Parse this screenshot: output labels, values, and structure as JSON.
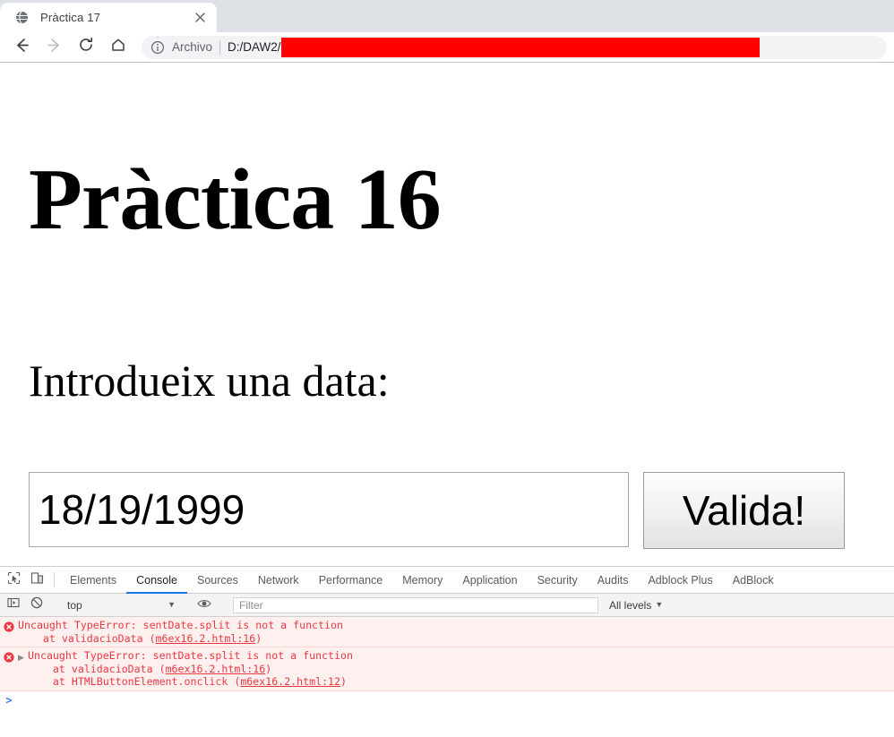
{
  "browser": {
    "tab": {
      "title": "Pràctica 17",
      "favicon_icon": "globe-icon",
      "close_icon": "close-icon"
    },
    "new_tab_icon": "plus-icon",
    "nav": {
      "back_icon": "arrow-left-icon",
      "forward_icon": "arrow-right-icon",
      "reload_icon": "reload-icon",
      "home_icon": "home-icon"
    },
    "omnibox": {
      "info_icon": "info-circle-icon",
      "scheme_label": "Archivo",
      "path": "D:/DAW2/",
      "redaction_color": "#fe0000"
    }
  },
  "page": {
    "heading": "Pràctica 16",
    "subheading": "Introdueix una data:",
    "date_input_value": "18/19/1999",
    "date_input_placeholder": "",
    "validate_button_label": "Valida!"
  },
  "devtools": {
    "toolbar_icons": {
      "inspect": "inspect-element-icon",
      "device": "device-toolbar-icon"
    },
    "tabs": [
      {
        "label": "Elements",
        "active": false
      },
      {
        "label": "Console",
        "active": true
      },
      {
        "label": "Sources",
        "active": false
      },
      {
        "label": "Network",
        "active": false
      },
      {
        "label": "Performance",
        "active": false
      },
      {
        "label": "Memory",
        "active": false
      },
      {
        "label": "Application",
        "active": false
      },
      {
        "label": "Security",
        "active": false
      },
      {
        "label": "Audits",
        "active": false
      },
      {
        "label": "Adblock Plus",
        "active": false
      },
      {
        "label": "AdBlock",
        "active": false
      }
    ],
    "active_tab_underline_color": "#1a73e8",
    "filterbar": {
      "sidebar_icon": "console-sidebar-icon",
      "clear_icon": "clear-console-icon",
      "context": "top",
      "context_caret": "▼",
      "eye_icon": "eye-icon",
      "filter_placeholder": "Filter",
      "filter_value": "",
      "levels_label": "All levels",
      "levels_caret": "▼"
    },
    "console": {
      "error_icon": "error-circle-icon",
      "expander_icon": "triangle-right-icon",
      "prompt_chevron": ">",
      "messages": [
        {
          "expandable": false,
          "text": "Uncaught TypeError: sentDate.split is not a function",
          "frames": [
            {
              "prefix": "    at validacioData (",
              "link": "m6ex16.2.html:16",
              "suffix": ")"
            }
          ]
        },
        {
          "expandable": true,
          "text": "Uncaught TypeError: sentDate.split is not a function",
          "frames": [
            {
              "prefix": "    at validacioData (",
              "link": "m6ex16.2.html:16",
              "suffix": ")"
            },
            {
              "prefix": "    at HTMLButtonElement.onclick (",
              "link": "m6ex16.2.html:12",
              "suffix": ")"
            }
          ]
        }
      ]
    }
  }
}
